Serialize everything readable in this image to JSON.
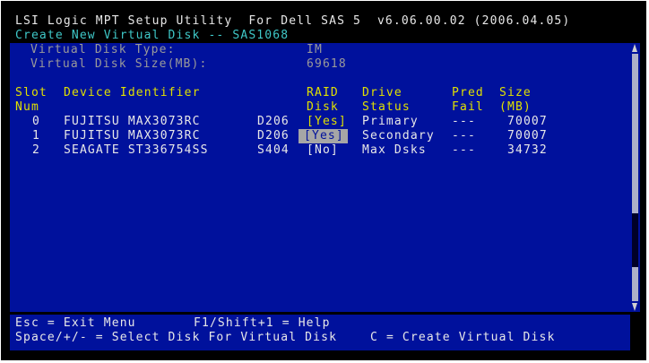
{
  "header": {
    "title": "LSI Logic MPT Setup Utility  For Dell SAS 5  v6.06.00.02 (2006.04.05)",
    "subtitle": "Create New Virtual Disk -- SAS1068"
  },
  "virtual_disk": {
    "type_label": "Virtual Disk Type:",
    "type_value": "IM",
    "size_label": "Virtual Disk Size(MB):",
    "size_value": "69618"
  },
  "table": {
    "headers_line1": {
      "slot": "Slot",
      "device": "Device Identifier",
      "raid": "RAID",
      "drive": "Drive",
      "pred": "Pred",
      "size": "Size"
    },
    "headers_line2": {
      "slot": "Num",
      "raid": "Disk",
      "drive": "Status",
      "pred": "Fail",
      "size": "(MB)"
    },
    "rows": [
      {
        "slot": "0",
        "device": "FUJITSU MAX3073RC",
        "rev": "D206",
        "raid": "[Yes]",
        "status": "Primary",
        "fail": "---",
        "size": "70007"
      },
      {
        "slot": "1",
        "device": "FUJITSU MAX3073RC",
        "rev": "D206",
        "raid": "[Yes]",
        "status": "Secondary",
        "fail": "---",
        "size": "70007"
      },
      {
        "slot": "2",
        "device": "SEAGATE ST336754SS",
        "rev": "S404",
        "raid": "[No]",
        "status": "Max Dsks",
        "fail": "---",
        "size": "34732"
      }
    ]
  },
  "footer": {
    "line1_left": "Esc = Exit Menu",
    "line1_right": "F1/Shift+1 = Help",
    "line2_left": "Space/+/- = Select Disk For Virtual Disk",
    "line2_right": "C = Create Virtual Disk"
  }
}
